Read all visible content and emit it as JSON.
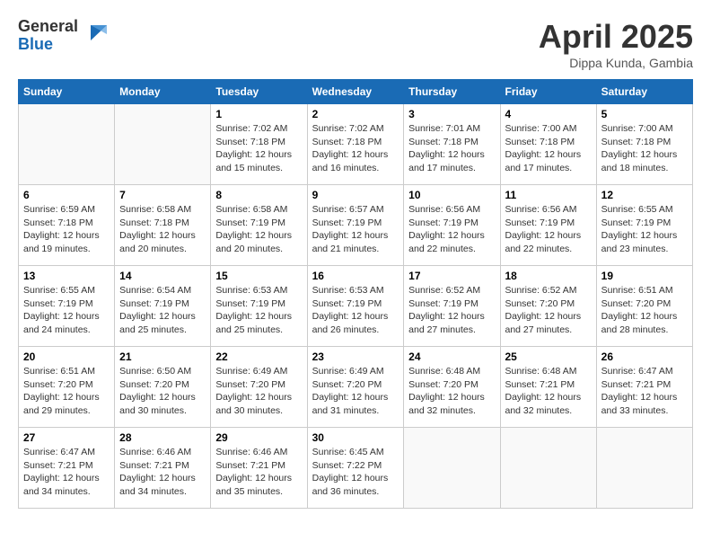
{
  "header": {
    "logo_line1": "General",
    "logo_line2": "Blue",
    "title": "April 2025",
    "location": "Dippa Kunda, Gambia"
  },
  "days_of_week": [
    "Sunday",
    "Monday",
    "Tuesday",
    "Wednesday",
    "Thursday",
    "Friday",
    "Saturday"
  ],
  "weeks": [
    [
      {
        "day": "",
        "sunrise": "",
        "sunset": "",
        "daylight": ""
      },
      {
        "day": "",
        "sunrise": "",
        "sunset": "",
        "daylight": ""
      },
      {
        "day": "1",
        "sunrise": "Sunrise: 7:02 AM",
        "sunset": "Sunset: 7:18 PM",
        "daylight": "Daylight: 12 hours and 15 minutes."
      },
      {
        "day": "2",
        "sunrise": "Sunrise: 7:02 AM",
        "sunset": "Sunset: 7:18 PM",
        "daylight": "Daylight: 12 hours and 16 minutes."
      },
      {
        "day": "3",
        "sunrise": "Sunrise: 7:01 AM",
        "sunset": "Sunset: 7:18 PM",
        "daylight": "Daylight: 12 hours and 17 minutes."
      },
      {
        "day": "4",
        "sunrise": "Sunrise: 7:00 AM",
        "sunset": "Sunset: 7:18 PM",
        "daylight": "Daylight: 12 hours and 17 minutes."
      },
      {
        "day": "5",
        "sunrise": "Sunrise: 7:00 AM",
        "sunset": "Sunset: 7:18 PM",
        "daylight": "Daylight: 12 hours and 18 minutes."
      }
    ],
    [
      {
        "day": "6",
        "sunrise": "Sunrise: 6:59 AM",
        "sunset": "Sunset: 7:18 PM",
        "daylight": "Daylight: 12 hours and 19 minutes."
      },
      {
        "day": "7",
        "sunrise": "Sunrise: 6:58 AM",
        "sunset": "Sunset: 7:18 PM",
        "daylight": "Daylight: 12 hours and 20 minutes."
      },
      {
        "day": "8",
        "sunrise": "Sunrise: 6:58 AM",
        "sunset": "Sunset: 7:19 PM",
        "daylight": "Daylight: 12 hours and 20 minutes."
      },
      {
        "day": "9",
        "sunrise": "Sunrise: 6:57 AM",
        "sunset": "Sunset: 7:19 PM",
        "daylight": "Daylight: 12 hours and 21 minutes."
      },
      {
        "day": "10",
        "sunrise": "Sunrise: 6:56 AM",
        "sunset": "Sunset: 7:19 PM",
        "daylight": "Daylight: 12 hours and 22 minutes."
      },
      {
        "day": "11",
        "sunrise": "Sunrise: 6:56 AM",
        "sunset": "Sunset: 7:19 PM",
        "daylight": "Daylight: 12 hours and 22 minutes."
      },
      {
        "day": "12",
        "sunrise": "Sunrise: 6:55 AM",
        "sunset": "Sunset: 7:19 PM",
        "daylight": "Daylight: 12 hours and 23 minutes."
      }
    ],
    [
      {
        "day": "13",
        "sunrise": "Sunrise: 6:55 AM",
        "sunset": "Sunset: 7:19 PM",
        "daylight": "Daylight: 12 hours and 24 minutes."
      },
      {
        "day": "14",
        "sunrise": "Sunrise: 6:54 AM",
        "sunset": "Sunset: 7:19 PM",
        "daylight": "Daylight: 12 hours and 25 minutes."
      },
      {
        "day": "15",
        "sunrise": "Sunrise: 6:53 AM",
        "sunset": "Sunset: 7:19 PM",
        "daylight": "Daylight: 12 hours and 25 minutes."
      },
      {
        "day": "16",
        "sunrise": "Sunrise: 6:53 AM",
        "sunset": "Sunset: 7:19 PM",
        "daylight": "Daylight: 12 hours and 26 minutes."
      },
      {
        "day": "17",
        "sunrise": "Sunrise: 6:52 AM",
        "sunset": "Sunset: 7:19 PM",
        "daylight": "Daylight: 12 hours and 27 minutes."
      },
      {
        "day": "18",
        "sunrise": "Sunrise: 6:52 AM",
        "sunset": "Sunset: 7:20 PM",
        "daylight": "Daylight: 12 hours and 27 minutes."
      },
      {
        "day": "19",
        "sunrise": "Sunrise: 6:51 AM",
        "sunset": "Sunset: 7:20 PM",
        "daylight": "Daylight: 12 hours and 28 minutes."
      }
    ],
    [
      {
        "day": "20",
        "sunrise": "Sunrise: 6:51 AM",
        "sunset": "Sunset: 7:20 PM",
        "daylight": "Daylight: 12 hours and 29 minutes."
      },
      {
        "day": "21",
        "sunrise": "Sunrise: 6:50 AM",
        "sunset": "Sunset: 7:20 PM",
        "daylight": "Daylight: 12 hours and 30 minutes."
      },
      {
        "day": "22",
        "sunrise": "Sunrise: 6:49 AM",
        "sunset": "Sunset: 7:20 PM",
        "daylight": "Daylight: 12 hours and 30 minutes."
      },
      {
        "day": "23",
        "sunrise": "Sunrise: 6:49 AM",
        "sunset": "Sunset: 7:20 PM",
        "daylight": "Daylight: 12 hours and 31 minutes."
      },
      {
        "day": "24",
        "sunrise": "Sunrise: 6:48 AM",
        "sunset": "Sunset: 7:20 PM",
        "daylight": "Daylight: 12 hours and 32 minutes."
      },
      {
        "day": "25",
        "sunrise": "Sunrise: 6:48 AM",
        "sunset": "Sunset: 7:21 PM",
        "daylight": "Daylight: 12 hours and 32 minutes."
      },
      {
        "day": "26",
        "sunrise": "Sunrise: 6:47 AM",
        "sunset": "Sunset: 7:21 PM",
        "daylight": "Daylight: 12 hours and 33 minutes."
      }
    ],
    [
      {
        "day": "27",
        "sunrise": "Sunrise: 6:47 AM",
        "sunset": "Sunset: 7:21 PM",
        "daylight": "Daylight: 12 hours and 34 minutes."
      },
      {
        "day": "28",
        "sunrise": "Sunrise: 6:46 AM",
        "sunset": "Sunset: 7:21 PM",
        "daylight": "Daylight: 12 hours and 34 minutes."
      },
      {
        "day": "29",
        "sunrise": "Sunrise: 6:46 AM",
        "sunset": "Sunset: 7:21 PM",
        "daylight": "Daylight: 12 hours and 35 minutes."
      },
      {
        "day": "30",
        "sunrise": "Sunrise: 6:45 AM",
        "sunset": "Sunset: 7:22 PM",
        "daylight": "Daylight: 12 hours and 36 minutes."
      },
      {
        "day": "",
        "sunrise": "",
        "sunset": "",
        "daylight": ""
      },
      {
        "day": "",
        "sunrise": "",
        "sunset": "",
        "daylight": ""
      },
      {
        "day": "",
        "sunrise": "",
        "sunset": "",
        "daylight": ""
      }
    ]
  ]
}
